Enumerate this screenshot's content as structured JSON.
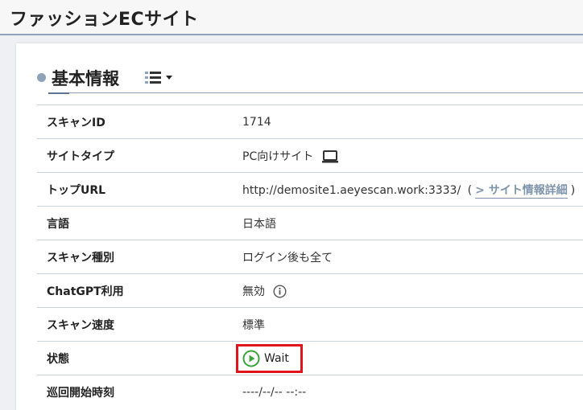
{
  "header": {
    "title": "ファッションECサイト"
  },
  "section": {
    "title": "基本情報"
  },
  "rows": [
    {
      "label": "スキャンID",
      "value": "1714"
    },
    {
      "label": "サイトタイプ",
      "value": "PC向けサイト"
    },
    {
      "label": "トップURL",
      "value": "http://demosite1.aeyescan.work:3333/",
      "link_label": "> サイト情報詳細",
      "paren_open": "(",
      "paren_close": ")"
    },
    {
      "label": "言語",
      "value": "日本語"
    },
    {
      "label": "スキャン種別",
      "value": "ログイン後も全て"
    },
    {
      "label": "ChatGPT利用",
      "value": "無効"
    },
    {
      "label": "スキャン速度",
      "value": "標準"
    },
    {
      "label": "状態",
      "value": "Wait"
    },
    {
      "label": "巡回開始時刻",
      "value": "----/--/-- --:--"
    }
  ],
  "icons": {
    "site_type": "monitor-icon",
    "chatgpt_info": "info-icon",
    "status": "play-icon",
    "section_menu": "list-icon"
  },
  "colors": {
    "accent": "#8fa3b8",
    "link": "#7d94ab",
    "status_green": "#3aa33a",
    "highlight_red": "#e0141b"
  }
}
